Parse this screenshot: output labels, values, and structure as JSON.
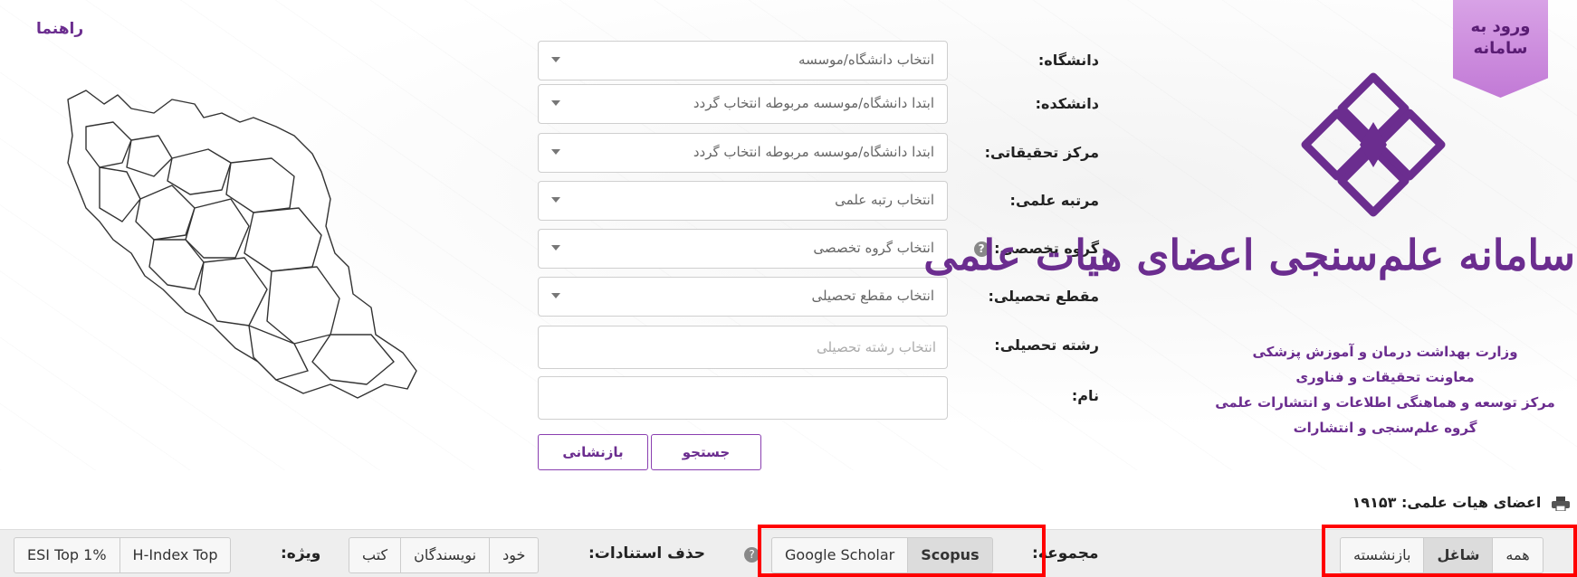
{
  "header": {
    "guide_link": "راهنما",
    "login_line1": "ورود به",
    "login_line2": "سامانه"
  },
  "logo": {
    "title": "سامانه علم‌سنجی اعضای هیات علمی",
    "org_lines": [
      "وزارت بهداشت درمان و آموزش پزشکی",
      "معاونت تحقیقات و فناوری",
      "مرکز توسعه و هماهنگی اطلاعات و انتشارات علمی",
      "گروه علم‌سنجی و انتشارات"
    ],
    "accent_color": "#6b2d8f"
  },
  "form": {
    "university": {
      "label": "دانشگاه:",
      "value": "انتخاب دانشگاه/موسسه"
    },
    "faculty": {
      "label": "دانشکده:",
      "value": "ابتدا دانشگاه/موسسه مربوطه انتخاب گردد"
    },
    "research_center": {
      "label": "مرکز تحقیقاتی:",
      "value": "ابتدا دانشگاه/موسسه مربوطه انتخاب گردد"
    },
    "rank": {
      "label": "مرتبه علمی:",
      "value": "انتخاب رتبه علمی"
    },
    "specialty_group": {
      "label": "گروه تخصصی:",
      "value": "انتخاب گروه تخصصی",
      "help": "?"
    },
    "degree": {
      "label": "مقطع تحصیلی:",
      "value": "انتخاب مقطع تحصیلی"
    },
    "field": {
      "label": "رشته تحصیلی:",
      "placeholder": "انتخاب رشته تحصیلی"
    },
    "name": {
      "label": "نام:",
      "value": ""
    },
    "search_button": "جستجو",
    "reset_button": "بازنشانی"
  },
  "stats": {
    "faculty_count_label": "اعضای هیات علمی:",
    "faculty_count": "۱۹۱۵۳"
  },
  "toolbar": {
    "status_tabs": [
      "همه",
      "شاغل",
      "بازنشسته"
    ],
    "status_active": "شاغل",
    "collection_label": "مجموعه:",
    "collection_tabs": [
      "Scopus",
      "Google Scholar"
    ],
    "collection_active": "Scopus",
    "citation_label": "حذف استنادات:",
    "citation_help": "?",
    "citation_tabs": [
      "خود",
      "نویسندگان",
      "کتب"
    ],
    "special_label": "ویژه:",
    "special_tabs": [
      "H-Index Top",
      "ESI Top 1%"
    ],
    "highlight_color": "#ff0000"
  }
}
